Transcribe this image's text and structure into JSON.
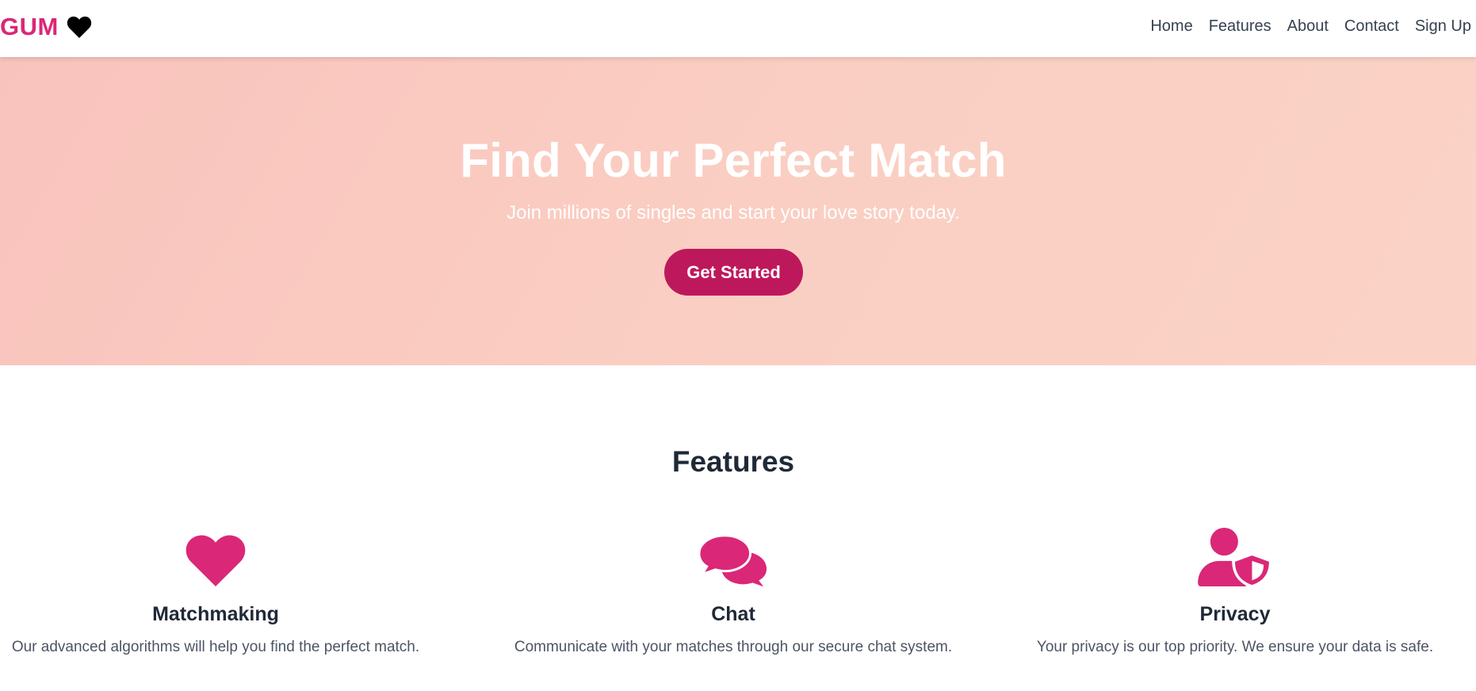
{
  "brand": {
    "name": "GUM",
    "color": "#db2777"
  },
  "nav": {
    "items": [
      {
        "label": "Home"
      },
      {
        "label": "Features"
      },
      {
        "label": "About"
      },
      {
        "label": "Contact"
      },
      {
        "label": "Sign Up"
      }
    ]
  },
  "hero": {
    "title": "Find Your Perfect Match",
    "subtitle": "Join millions of singles and start your love story today.",
    "cta_label": "Get Started",
    "background_color": "#facfc3",
    "button_color": "#be185d"
  },
  "features": {
    "heading": "Features",
    "accent_color": "#db2777",
    "items": [
      {
        "icon": "heart-icon",
        "title": "Matchmaking",
        "text": "Our advanced algorithms will help you find the perfect match."
      },
      {
        "icon": "chat-bubbles-icon",
        "title": "Chat",
        "text": "Communicate with your matches through our secure chat system."
      },
      {
        "icon": "user-shield-icon",
        "title": "Privacy",
        "text": "Your privacy is our top priority. We ensure your data is safe."
      }
    ]
  }
}
